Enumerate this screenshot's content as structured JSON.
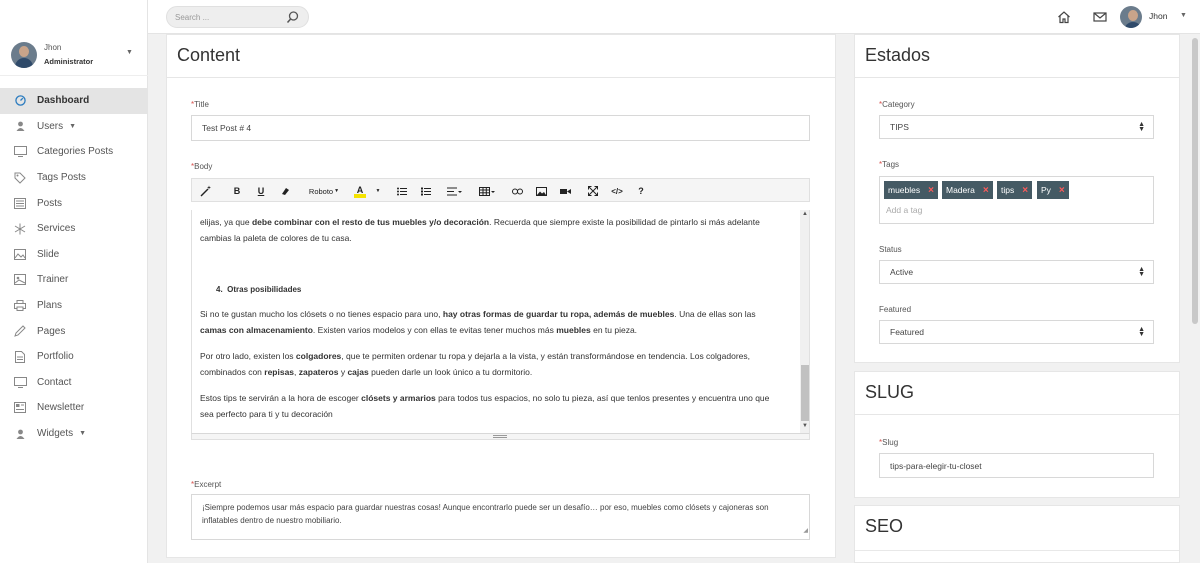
{
  "topbar": {
    "search_placeholder": "Search ...",
    "user_name": "Jhon"
  },
  "sidebar": {
    "user_name": "Jhon",
    "user_role": "Administrator",
    "items": [
      {
        "label": "Dashboard",
        "icon": "dashboard-icon",
        "active": true
      },
      {
        "label": "Users",
        "icon": "user-icon",
        "caret": true
      },
      {
        "label": "Categories Posts",
        "icon": "screen-icon"
      },
      {
        "label": "Tags Posts",
        "icon": "tag-icon"
      },
      {
        "label": "Posts",
        "icon": "newspaper-icon"
      },
      {
        "label": "Services",
        "icon": "asterisk-icon"
      },
      {
        "label": "Slide",
        "icon": "image-icon"
      },
      {
        "label": "Trainer",
        "icon": "photo-icon"
      },
      {
        "label": "Plans",
        "icon": "print-icon"
      },
      {
        "label": "Pages",
        "icon": "pencil-icon"
      },
      {
        "label": "Portfolio",
        "icon": "file-icon"
      },
      {
        "label": "Contact",
        "icon": "screen-icon"
      },
      {
        "label": "Newsletter",
        "icon": "newspaper-icon"
      },
      {
        "label": "Widgets",
        "icon": "user-icon",
        "caret": true
      }
    ]
  },
  "content": {
    "title": "Content",
    "title_label": "Title",
    "title_value": "Test Post # 4",
    "body_label": "Body",
    "font_name": "Roboto",
    "body_paragraphs": {
      "p1_a": "elijas, ya que ",
      "p1_b": "debe combinar con el resto de tus muebles y/o decoración",
      "p1_c": ". Recuerda que siempre existe la posibilidad de pintarlo si más adelante",
      "p1_d": "cambias la paleta de colores de tu casa.",
      "h4_num": "4.",
      "h4_text": "Otras posibilidades",
      "p2_a": "Si no te gustan mucho los clósets o no tienes espacio para uno, ",
      "p2_b": "hay otras formas de guardar tu ropa, además de muebles",
      "p2_c": ". Una de ellas son las",
      "p2_d": "camas con almacenamiento",
      "p2_e": ". Existen varios modelos y con ellas te evitas tener muchos más ",
      "p2_f": "muebles",
      "p2_g": " en tu pieza.",
      "p3_a": "Por otro lado, existen los ",
      "p3_b": "colgadores",
      "p3_c": ", que te permiten ordenar tu ropa y dejarla a la vista, y están transformándose en tendencia. Los colgadores,",
      "p3_d": "combinados con ",
      "p3_e": "repisas",
      "p3_f": ", ",
      "p3_g": "zapateros",
      "p3_h": " y ",
      "p3_i": "cajas",
      "p3_j": " pueden darle un look único a tu dormitorio.",
      "p4_a": "Estos tips te servirán a la hora de escoger ",
      "p4_b": "clósets y armarios",
      "p4_c": " para todos tus espacios, no solo tu pieza, así que tenlos presentes y encuentra uno que",
      "p4_d": "sea perfecto para ti y tu decoración"
    },
    "excerpt_label": "Excerpt",
    "excerpt_value": "¡Siempre podemos usar más espacio para guardar nuestras cosas! Aunque encontrarlo puede ser un desafío… por eso, muebles como clósets y cajoneras son inflatables dentro de nuestro mobiliario."
  },
  "estados": {
    "title": "Estados",
    "category_label": "Category",
    "category_value": "TIPS",
    "tags_label": "Tags",
    "tags": [
      "muebles",
      "Madera",
      "tips",
      "Py"
    ],
    "tags_placeholder": "Add a tag",
    "status_label": "Status",
    "status_value": "Active",
    "featured_label": "Featured",
    "featured_value": "Featured"
  },
  "slug": {
    "title": "SLUG",
    "slug_label": "Slug",
    "slug_value": "tips-para-elegir-tu-closet"
  },
  "seo": {
    "title": "SEO"
  },
  "colors": {
    "accent": "#2a7bbf",
    "tag_bg": "#455a64",
    "tag_x": "#ff5a5a",
    "required": "#d9534f"
  }
}
